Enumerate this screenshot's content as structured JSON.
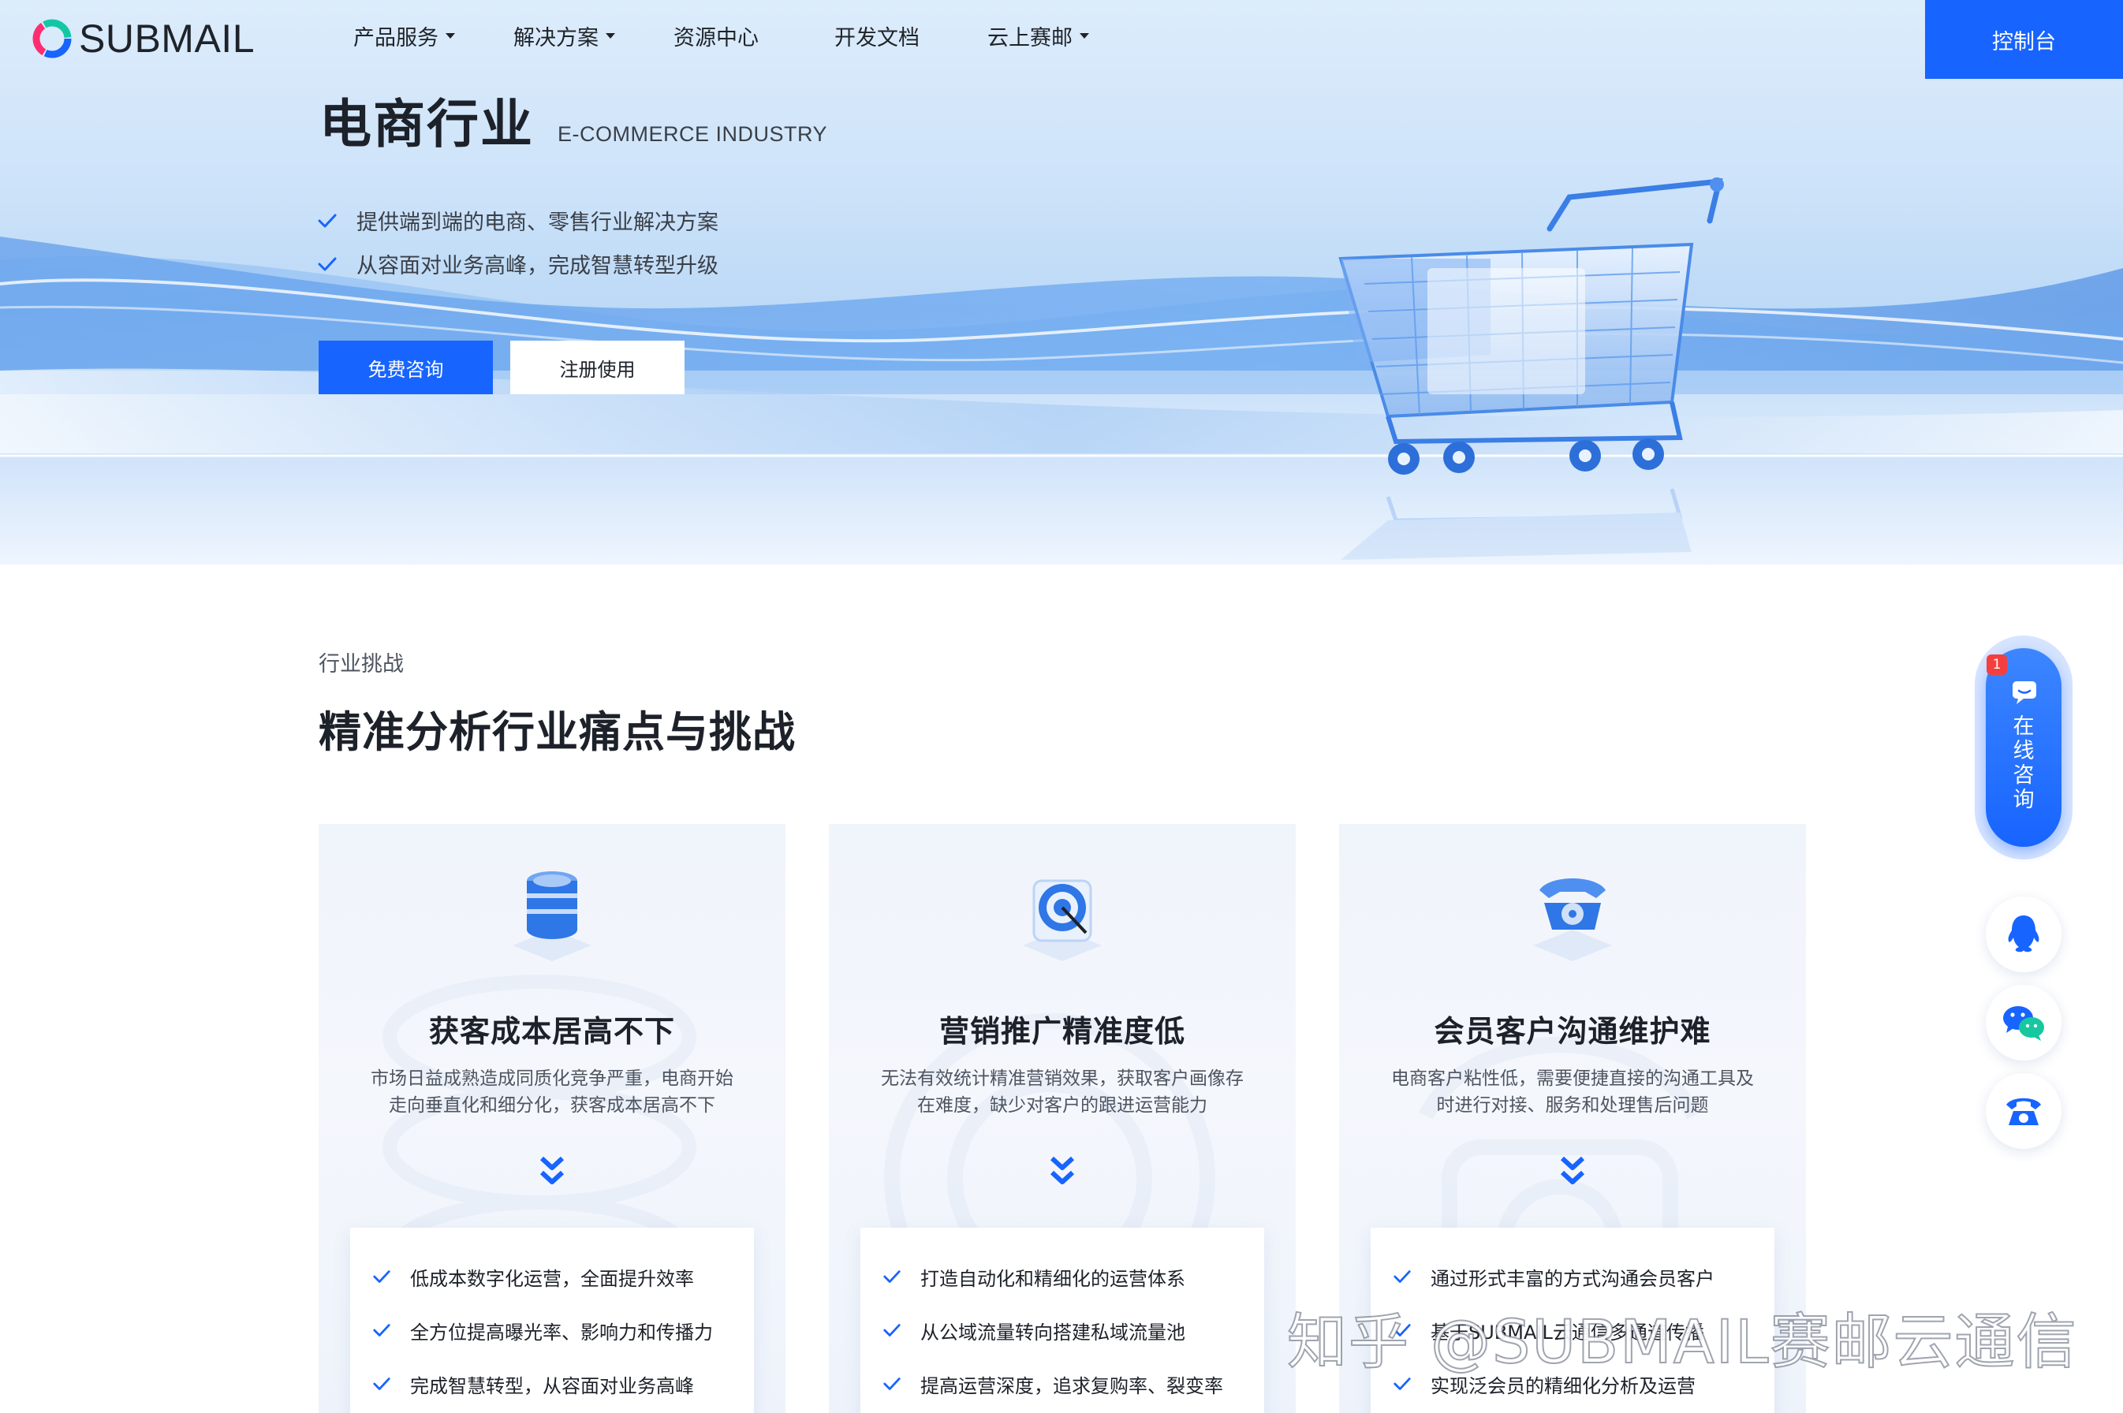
{
  "header": {
    "logo_text": "SUBMAIL",
    "nav": [
      {
        "label": "产品服务",
        "has_dropdown": true
      },
      {
        "label": "解决方案",
        "has_dropdown": true
      },
      {
        "label": "资源中心",
        "has_dropdown": false
      },
      {
        "label": "开发文档",
        "has_dropdown": false
      },
      {
        "label": "云上赛邮",
        "has_dropdown": true
      }
    ],
    "console_label": "控制台"
  },
  "hero": {
    "title": "电商行业",
    "title_en": "E-COMMERCE INDUSTRY",
    "points": [
      "提供端到端的电商、零售行业解决方案",
      "从容面对业务高峰，完成智慧转型升级"
    ],
    "primary_button": "免费咨询",
    "secondary_button": "注册使用"
  },
  "section": {
    "label": "行业挑战",
    "title": "精准分析行业痛点与挑战",
    "cards": [
      {
        "icon": "database-icon",
        "title": "获客成本居高不下",
        "desc_lines": [
          "市场日益成熟造成同质化竞争严重，电商开始",
          "走向垂直化和细分化，获客成本居高不下"
        ],
        "items": [
          "低成本数字化运营，全面提升效率",
          "全方位提高曝光率、影响力和传播力",
          "完成智慧转型，从容面对业务高峰"
        ]
      },
      {
        "icon": "target-icon",
        "title": "营销推广精准度低",
        "desc_lines": [
          "无法有效统计精准营销效果，获取客户画像存",
          "在难度，缺少对客户的跟进运营能力"
        ],
        "items": [
          "打造自动化和精细化的运营体系",
          "从公域流量转向搭建私域流量池",
          "提高运营深度，追求复购率、裂变率"
        ]
      },
      {
        "icon": "telephone-icon",
        "title": "会员客户沟通维护难",
        "desc_lines": [
          "电商客户粘性低，需要便捷直接的沟通工具及",
          "时进行对接、服务和处理售后问题"
        ],
        "items": [
          "通过形式丰富的方式沟通会员客户",
          "基于SUBMAIL云通信多通道传播",
          "实现泛会员的精细化分析及运营"
        ]
      }
    ]
  },
  "sidebar": {
    "consult_label": [
      "在",
      "线",
      "咨",
      "询"
    ],
    "badge_count": "1",
    "buttons": [
      "qq-icon",
      "wechat-icon",
      "phone-icon"
    ]
  },
  "watermark": "知乎 @SUBMAIL赛邮云通信",
  "colors": {
    "accent": "#1764ff",
    "text": "#1d2129",
    "muted": "#4e5561",
    "badge": "#f53f3f"
  }
}
